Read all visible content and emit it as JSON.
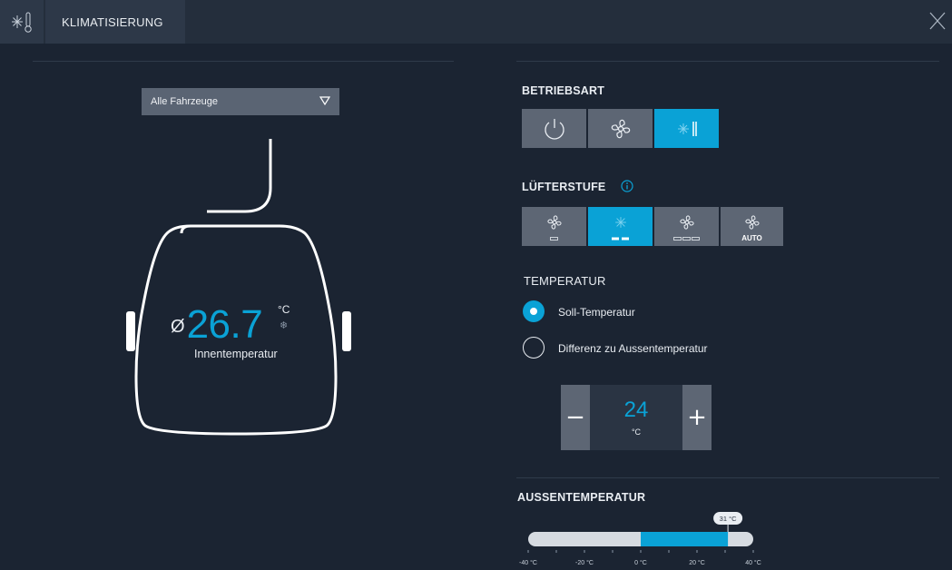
{
  "header": {
    "title": "KLIMATISIERUNG",
    "app_icon": "snowflake-thermometer-icon",
    "close_icon": "close-icon"
  },
  "vehicle": {
    "selector": {
      "value": "Alle Fahrzeuge"
    },
    "average_symbol": "Ø",
    "inner_temp": "26.7",
    "unit": "°C",
    "inner_label": "Innentemperatur"
  },
  "betriebsart": {
    "title": "BETRIEBSART",
    "options": [
      {
        "icon": "power-icon",
        "active": false
      },
      {
        "icon": "fan-icon",
        "active": false
      },
      {
        "icon": "snowflake-thermometer-icon",
        "active": true
      }
    ]
  },
  "luefterstufe": {
    "title": "LÜFTERSTUFE",
    "info_icon": "info-icon",
    "levels": [
      {
        "icon": "fan-icon",
        "sub": "",
        "active": false
      },
      {
        "icon": "fan-icon",
        "sub": "",
        "active": true
      },
      {
        "icon": "fan-icon",
        "sub": "",
        "active": false
      },
      {
        "icon": "fan-icon",
        "sub": "AUTO",
        "active": false
      }
    ]
  },
  "temperatur": {
    "title": "TEMPERATUR",
    "options": [
      {
        "label": "Soll-Temperatur",
        "selected": true
      },
      {
        "label": "Differenz zu Aussentemperatur",
        "selected": false
      }
    ],
    "stepper": {
      "value": "24",
      "unit": "°C",
      "minus": "−",
      "plus": "+"
    }
  },
  "aussentemperatur": {
    "title": "AUSSENTEMPERATUR",
    "current_label": "31 °C",
    "current_value": 31,
    "range": [
      -40,
      40
    ],
    "ticks": [
      "-40 °C",
      "-20 °C",
      "0 °C",
      "20 °C",
      "40 °C"
    ],
    "colors": {
      "track": "#d6dbe1",
      "fill": "#0aa2d6"
    }
  }
}
